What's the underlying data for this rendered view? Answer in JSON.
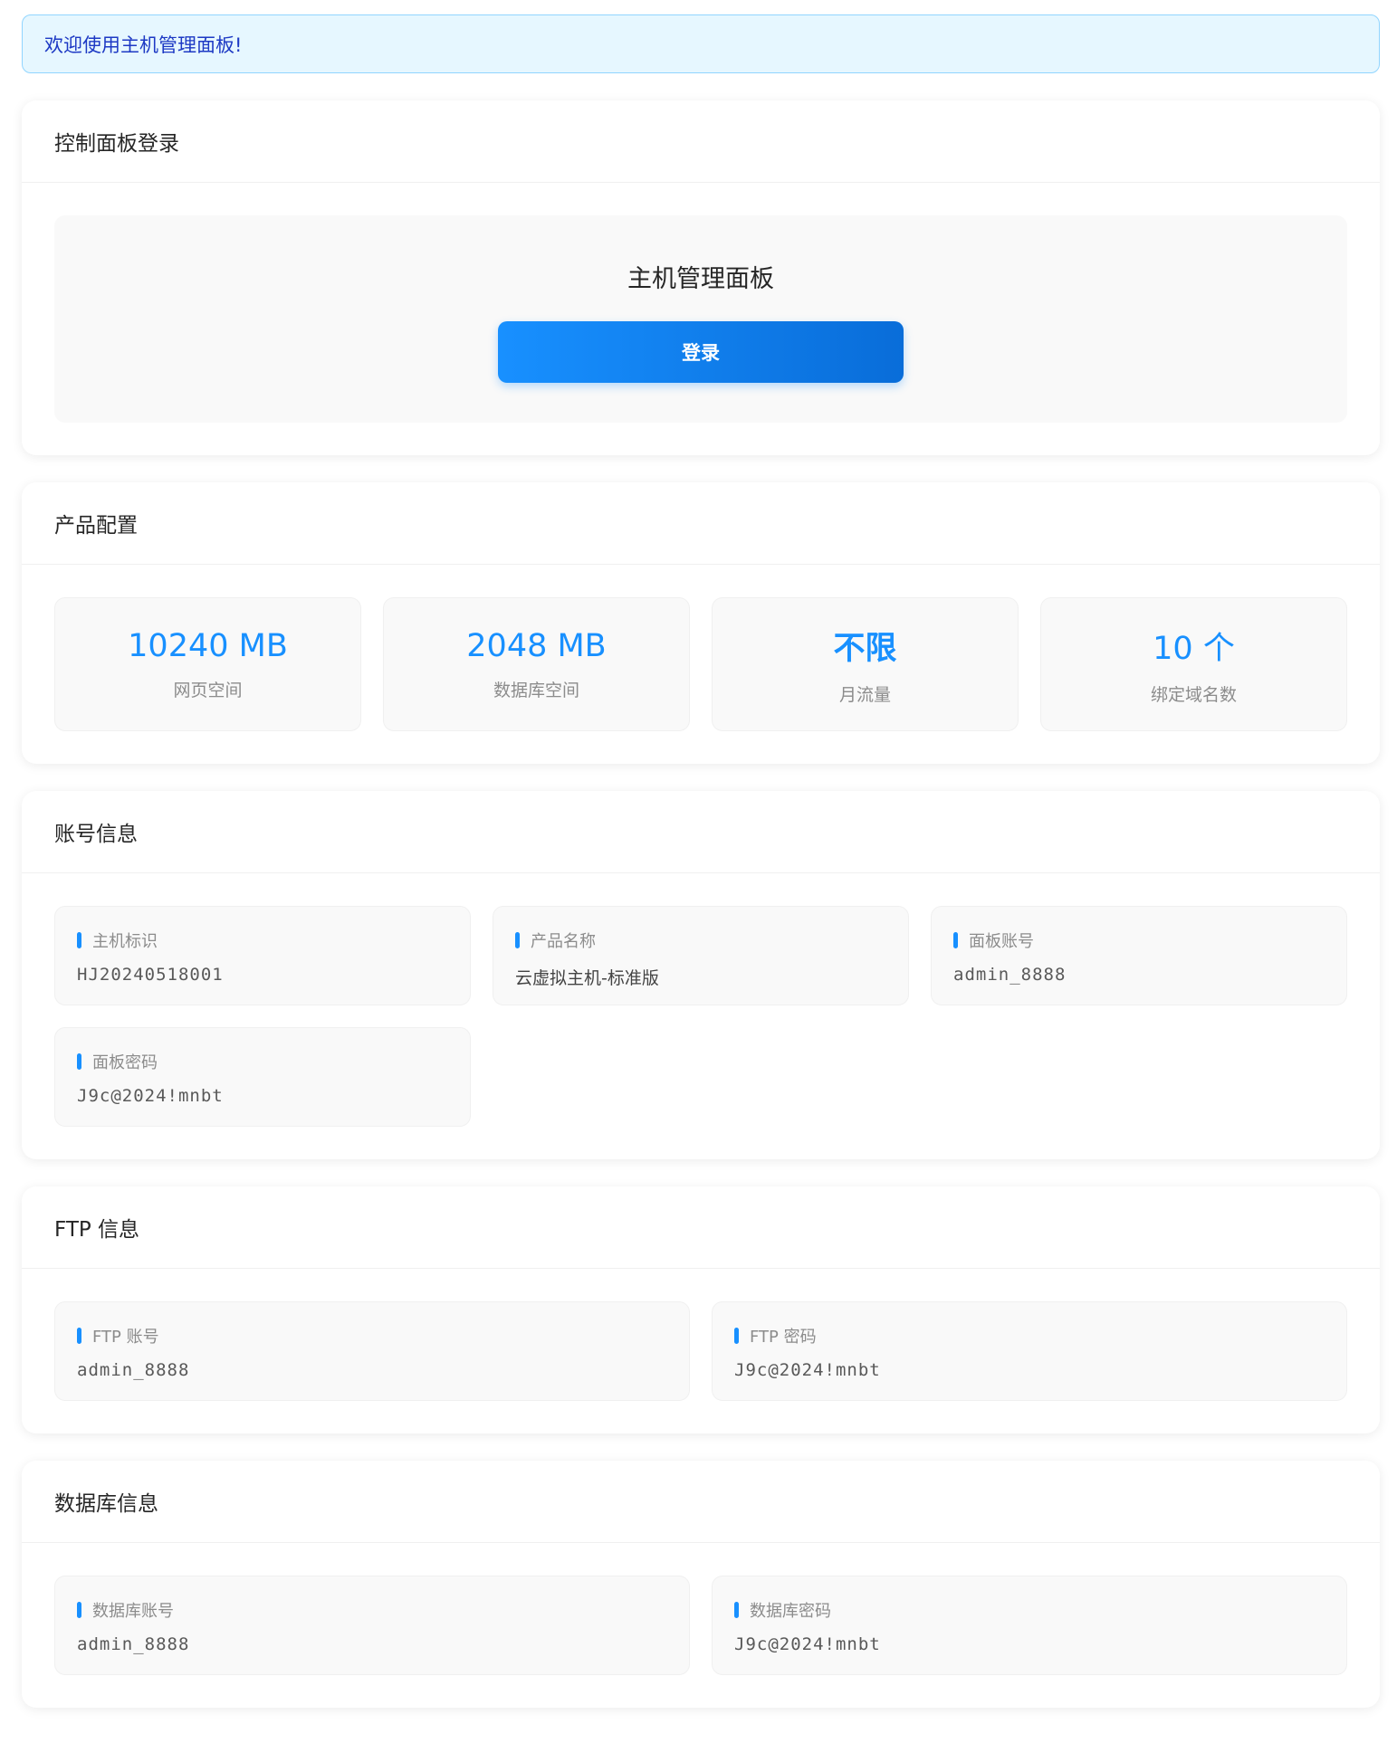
{
  "alert": {
    "text": "欢迎使用主机管理面板!"
  },
  "login_card": {
    "title": "控制面板登录",
    "panel_title": "主机管理面板",
    "login_label": "登录"
  },
  "config_card": {
    "title": "产品配置",
    "stats": [
      {
        "value": "10240 MB",
        "label": "网页空间"
      },
      {
        "value": "2048 MB",
        "label": "数据库空间"
      },
      {
        "value": "不限",
        "label": "月流量"
      },
      {
        "value": "10 个",
        "label": "绑定域名数"
      }
    ]
  },
  "account_card": {
    "title": "账号信息",
    "items": [
      {
        "label": "主机标识",
        "value": "HJ20240518001"
      },
      {
        "label": "产品名称",
        "value": "云虚拟主机-标准版"
      },
      {
        "label": "面板账号",
        "value": "admin_8888"
      },
      {
        "label": "面板密码",
        "value": "J9c@2024!mnbt"
      }
    ]
  },
  "ftp_card": {
    "title": "FTP 信息",
    "items": [
      {
        "label": "FTP 账号",
        "value": "admin_8888"
      },
      {
        "label": "FTP 密码",
        "value": "J9c@2024!mnbt"
      }
    ]
  },
  "db_card": {
    "title": "数据库信息",
    "items": [
      {
        "label": "数据库账号",
        "value": "admin_8888"
      },
      {
        "label": "数据库密码",
        "value": "J9c@2024!mnbt"
      }
    ]
  },
  "colors": {
    "accent": "#1890ff",
    "alert_bg": "#e6f7ff",
    "alert_border": "#91d5ff",
    "alert_text": "#1d39c4"
  }
}
